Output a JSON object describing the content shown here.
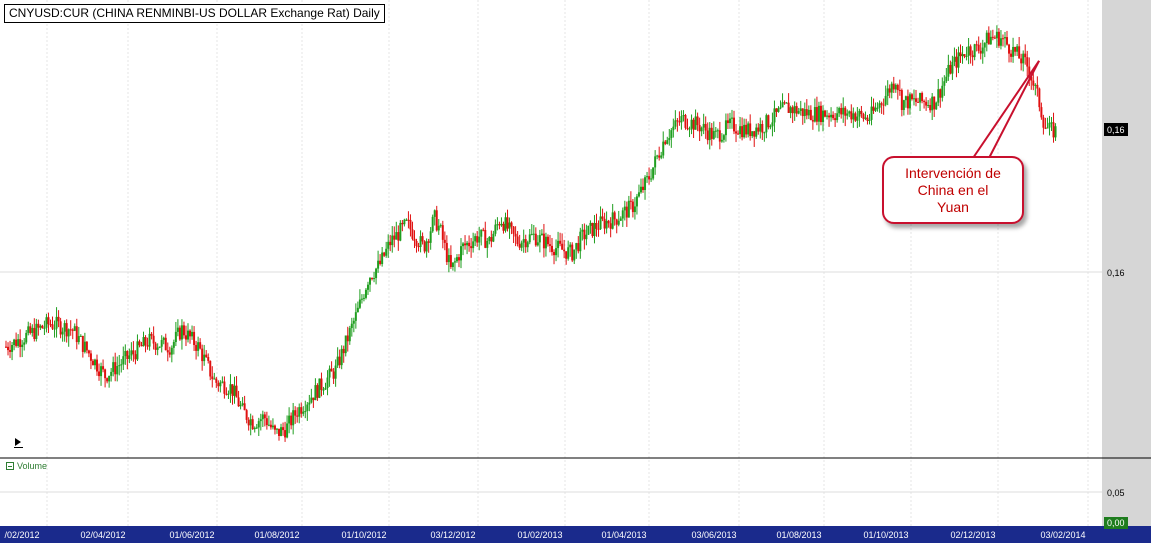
{
  "chart_data": {
    "type": "candlestick",
    "title": "CNYUSD:CUR (CHINA RENMINBI-US DOLLAR Exchange Rat) Daily",
    "x_ticks": [
      "/02/2012",
      "02/04/2012",
      "01/06/2012",
      "01/08/2012",
      "01/10/2012",
      "03/12/2012",
      "01/02/2013",
      "01/04/2013",
      "03/06/2013",
      "01/08/2013",
      "01/10/2013",
      "02/12/2013",
      "03/02/2014"
    ],
    "y_ticks_price": [
      "0,16"
    ],
    "y_ticks_volume": [
      "0,05"
    ],
    "last_value_label": "0,16",
    "volume_value_label": "0,00",
    "volume_label": "Volume",
    "annotation": {
      "text": [
        "Intervención de",
        "China en el",
        "Yuan"
      ]
    },
    "series": [
      {
        "values": [
          [
            0.0,
            0.1572
          ],
          [
            0.02,
            0.1574
          ],
          [
            0.04,
            0.1576
          ],
          [
            0.06,
            0.1575
          ],
          [
            0.075,
            0.1571
          ],
          [
            0.09,
            0.1567
          ],
          [
            0.11,
            0.157
          ],
          [
            0.13,
            0.1573
          ],
          [
            0.15,
            0.1572
          ],
          [
            0.16,
            0.1575
          ],
          [
            0.175,
            0.1572
          ],
          [
            0.19,
            0.1566
          ],
          [
            0.205,
            0.1565
          ],
          [
            0.215,
            0.1561
          ],
          [
            0.225,
            0.1559
          ],
          [
            0.235,
            0.156
          ],
          [
            0.245,
            0.1557
          ],
          [
            0.255,
            0.1558
          ],
          [
            0.265,
            0.1561
          ],
          [
            0.285,
            0.1565
          ],
          [
            0.3,
            0.1568
          ],
          [
            0.32,
            0.1578
          ],
          [
            0.33,
            0.1584
          ],
          [
            0.34,
            0.1586
          ],
          [
            0.35,
            0.159
          ],
          [
            0.365,
            0.1593
          ],
          [
            0.38,
            0.1589
          ],
          [
            0.39,
            0.1594
          ],
          [
            0.395,
            0.1592
          ],
          [
            0.405,
            0.1585
          ],
          [
            0.415,
            0.1589
          ],
          [
            0.43,
            0.1591
          ],
          [
            0.44,
            0.159
          ],
          [
            0.45,
            0.1594
          ],
          [
            0.465,
            0.159
          ],
          [
            0.48,
            0.1591
          ],
          [
            0.5,
            0.1589
          ],
          [
            0.515,
            0.1588
          ],
          [
            0.525,
            0.1591
          ],
          [
            0.54,
            0.1593
          ],
          [
            0.555,
            0.1594
          ],
          [
            0.57,
            0.1596
          ],
          [
            0.585,
            0.1601
          ],
          [
            0.6,
            0.1608
          ],
          [
            0.615,
            0.1611
          ],
          [
            0.63,
            0.161
          ],
          [
            0.645,
            0.1608
          ],
          [
            0.66,
            0.161
          ],
          [
            0.675,
            0.1609
          ],
          [
            0.69,
            0.161
          ],
          [
            0.71,
            0.1613
          ],
          [
            0.73,
            0.1612
          ],
          [
            0.75,
            0.1612
          ],
          [
            0.77,
            0.1612
          ],
          [
            0.785,
            0.1611
          ],
          [
            0.8,
            0.1615
          ],
          [
            0.81,
            0.1618
          ],
          [
            0.815,
            0.1614
          ],
          [
            0.83,
            0.1614
          ],
          [
            0.845,
            0.1614
          ],
          [
            0.86,
            0.162
          ],
          [
            0.875,
            0.1623
          ],
          [
            0.885,
            0.1623
          ],
          [
            0.895,
            0.1625
          ],
          [
            0.905,
            0.1625
          ],
          [
            0.915,
            0.1623
          ],
          [
            0.92,
            0.1622
          ],
          [
            0.93,
            0.162
          ],
          [
            0.94,
            0.1614
          ],
          [
            0.945,
            0.161
          ],
          [
            0.95,
            0.1609
          ],
          [
            0.955,
            0.1609
          ]
        ]
      }
    ]
  }
}
